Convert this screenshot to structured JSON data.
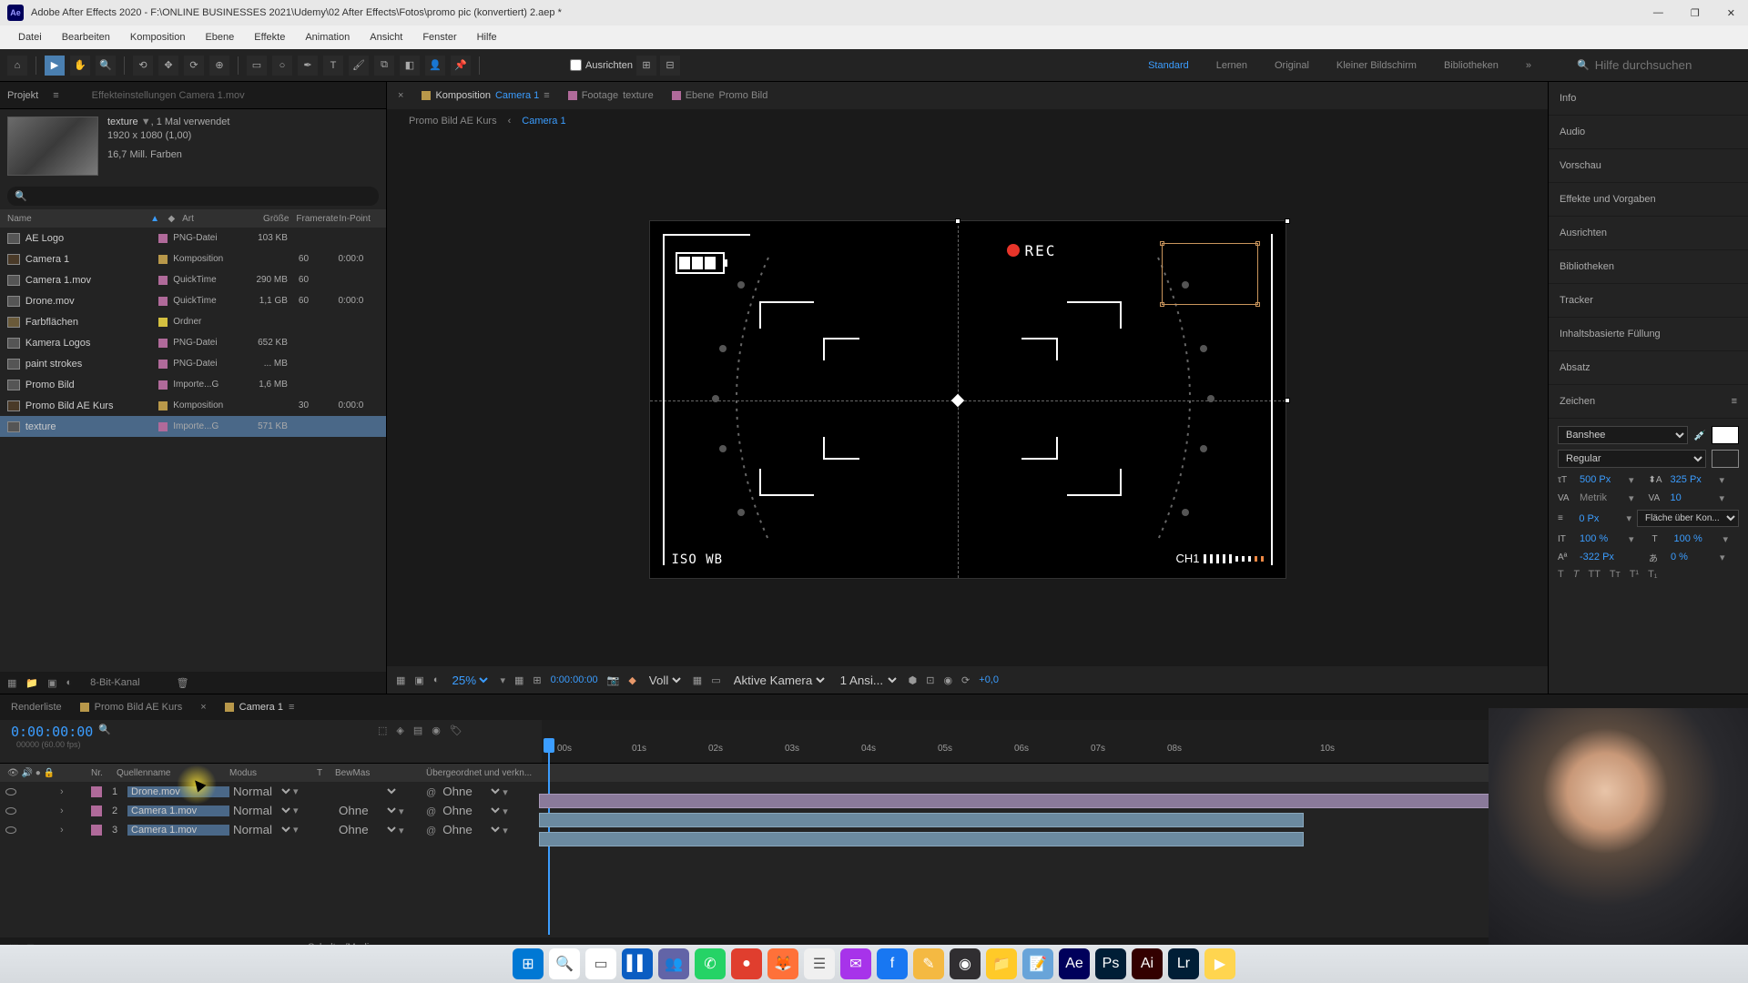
{
  "window": {
    "title": "Adobe After Effects 2020 - F:\\ONLINE BUSINESSES 2021\\Udemy\\02 After Effects\\Fotos\\promo pic (konvertiert) 2.aep *"
  },
  "menu": [
    "Datei",
    "Bearbeiten",
    "Komposition",
    "Ebene",
    "Effekte",
    "Animation",
    "Ansicht",
    "Fenster",
    "Hilfe"
  ],
  "toolbar": {
    "snap_label": "Ausrichten",
    "workspaces": [
      "Standard",
      "Lernen",
      "Original",
      "Kleiner Bildschirm",
      "Bibliotheken"
    ],
    "active_workspace": "Standard",
    "help_placeholder": "Hilfe durchsuchen"
  },
  "project": {
    "tab_project": "Projekt",
    "tab_effects": "Effekteinstellungen Camera 1.mov",
    "selected_name": "texture",
    "used": ", 1 Mal verwendet",
    "dims": "1920 x 1080 (1,00)",
    "colors": "16,7 Mill. Farben",
    "cols": {
      "name": "Name",
      "type": "Art",
      "size": "Größe",
      "fr": "Framerate",
      "in": "In-Point"
    },
    "items": [
      {
        "name": "AE Logo",
        "type": "PNG-Datei",
        "size": "103 KB",
        "fr": "",
        "in": "",
        "label": "#b06a9a"
      },
      {
        "name": "Camera 1",
        "type": "Komposition",
        "size": "",
        "fr": "60",
        "in": "0:00:0",
        "label": "#b8984a"
      },
      {
        "name": "Camera 1.mov",
        "type": "QuickTime",
        "size": "290 MB",
        "fr": "60",
        "in": "",
        "label": "#b06a9a"
      },
      {
        "name": "Drone.mov",
        "type": "QuickTime",
        "size": "1,1 GB",
        "fr": "60",
        "in": "0:00:0",
        "label": "#b06a9a"
      },
      {
        "name": "Farbflächen",
        "type": "Ordner",
        "size": "",
        "fr": "",
        "in": "",
        "label": "#d4c040"
      },
      {
        "name": "Kamera Logos",
        "type": "PNG-Datei",
        "size": "652 KB",
        "fr": "",
        "in": "",
        "label": "#b06a9a"
      },
      {
        "name": "paint strokes",
        "type": "PNG-Datei",
        "size": "... MB",
        "fr": "",
        "in": "",
        "label": "#b06a9a"
      },
      {
        "name": "Promo Bild",
        "type": "Importe...G",
        "size": "1,6 MB",
        "fr": "",
        "in": "",
        "label": "#b06a9a"
      },
      {
        "name": "Promo Bild AE Kurs",
        "type": "Komposition",
        "size": "",
        "fr": "30",
        "in": "0:00:0",
        "label": "#b8984a"
      },
      {
        "name": "texture",
        "type": "Importe...G",
        "size": "571 KB",
        "fr": "",
        "in": "",
        "label": "#b06a9a",
        "selected": true
      }
    ],
    "footer_bit": "8-Bit-Kanal"
  },
  "comp": {
    "tab_comp": "Komposition",
    "tab_comp_name": "Camera 1",
    "tab_footage": "Footage",
    "tab_footage_name": "texture",
    "tab_layer": "Ebene",
    "tab_layer_name": "Promo Bild",
    "crumb1": "Promo Bild AE Kurs",
    "crumb2": "Camera 1",
    "rec_label": "REC",
    "iso_label": "ISO  WB",
    "ch_label": "CH1",
    "footer": {
      "zoom": "25%",
      "time": "0:00:00:00",
      "res": "Voll",
      "camera": "Aktive Kamera",
      "views": "1 Ansi...",
      "exposure": "+0,0"
    }
  },
  "right": {
    "panels": [
      "Info",
      "Audio",
      "Vorschau",
      "Effekte und Vorgaben",
      "Ausrichten",
      "Bibliotheken",
      "Tracker",
      "Inhaltsbasierte Füllung",
      "Absatz"
    ],
    "char_title": "Zeichen",
    "font": "Banshee",
    "style": "Regular",
    "size": "500 Px",
    "leading": "325 Px",
    "kerning": "Metrik",
    "tracking": "10",
    "stroke": "0 Px",
    "stroke_opt": "Fläche über Kon...",
    "vscale": "100 %",
    "hscale": "100 %",
    "baseline": "-322 Px",
    "tsume": "0 %"
  },
  "timeline": {
    "tab_render": "Renderliste",
    "tab_comp1": "Promo Bild AE Kurs",
    "tab_comp2": "Camera 1",
    "time": "0:00:00:00",
    "fps": "00000 (60.00 fps)",
    "cols": {
      "nr": "Nr.",
      "name": "Quellenname",
      "mode": "Modus",
      "t": "T",
      "track": "BewMas",
      "parent": "Übergeordnet und verkn..."
    },
    "layers": [
      {
        "nr": "1",
        "name": "Drone.mov",
        "mode": "Normal",
        "track": "",
        "parent": "Ohne",
        "label": "#b06a9a",
        "bar_start": 0,
        "bar_len": 1250,
        "sel": true,
        "color": "purple"
      },
      {
        "nr": "2",
        "name": "Camera 1.mov",
        "mode": "Normal",
        "track": "Ohne",
        "parent": "Ohne",
        "label": "#b06a9a",
        "bar_start": 0,
        "bar_len": 840,
        "sel": true
      },
      {
        "nr": "3",
        "name": "Camera 1.mov",
        "mode": "Normal",
        "track": "Ohne",
        "parent": "Ohne",
        "label": "#b06a9a",
        "bar_start": 0,
        "bar_len": 840,
        "sel": true
      }
    ],
    "ruler": [
      "00s",
      "01s",
      "02s",
      "03s",
      "04s",
      "05s",
      "06s",
      "07s",
      "08s",
      "10s"
    ],
    "footer_modi": "Schalter/Modi"
  },
  "taskbar": {
    "items": [
      {
        "name": "start",
        "color": "#0078d4",
        "glyph": "⊞"
      },
      {
        "name": "search",
        "color": "#fff",
        "glyph": "🔍"
      },
      {
        "name": "taskview",
        "color": "#fff",
        "glyph": "▭"
      },
      {
        "name": "explorer",
        "color": "#0a5dc2",
        "glyph": "▌▌"
      },
      {
        "name": "teams",
        "color": "#6264a7",
        "glyph": "👥"
      },
      {
        "name": "whatsapp",
        "color": "#25d366",
        "glyph": "✆"
      },
      {
        "name": "app1",
        "color": "#e03e2e",
        "glyph": "●"
      },
      {
        "name": "firefox",
        "color": "#ff7139",
        "glyph": "🦊"
      },
      {
        "name": "app2",
        "color": "#f0f0f0",
        "glyph": "☰"
      },
      {
        "name": "messenger",
        "color": "#a733ea",
        "glyph": "✉"
      },
      {
        "name": "facebook",
        "color": "#1877f2",
        "glyph": "f"
      },
      {
        "name": "app3",
        "color": "#f4b942",
        "glyph": "✎"
      },
      {
        "name": "obs",
        "color": "#302e31",
        "glyph": "◉"
      },
      {
        "name": "files",
        "color": "#ffca28",
        "glyph": "📁"
      },
      {
        "name": "notes",
        "color": "#68a4d9",
        "glyph": "📝"
      },
      {
        "name": "ae",
        "color": "#00005b",
        "glyph": "Ae"
      },
      {
        "name": "ps",
        "color": "#001e36",
        "glyph": "Ps"
      },
      {
        "name": "ai",
        "color": "#330000",
        "glyph": "Ai"
      },
      {
        "name": "lr",
        "color": "#001e36",
        "glyph": "Lr"
      },
      {
        "name": "app4",
        "color": "#ffd54f",
        "glyph": "▶"
      }
    ]
  }
}
